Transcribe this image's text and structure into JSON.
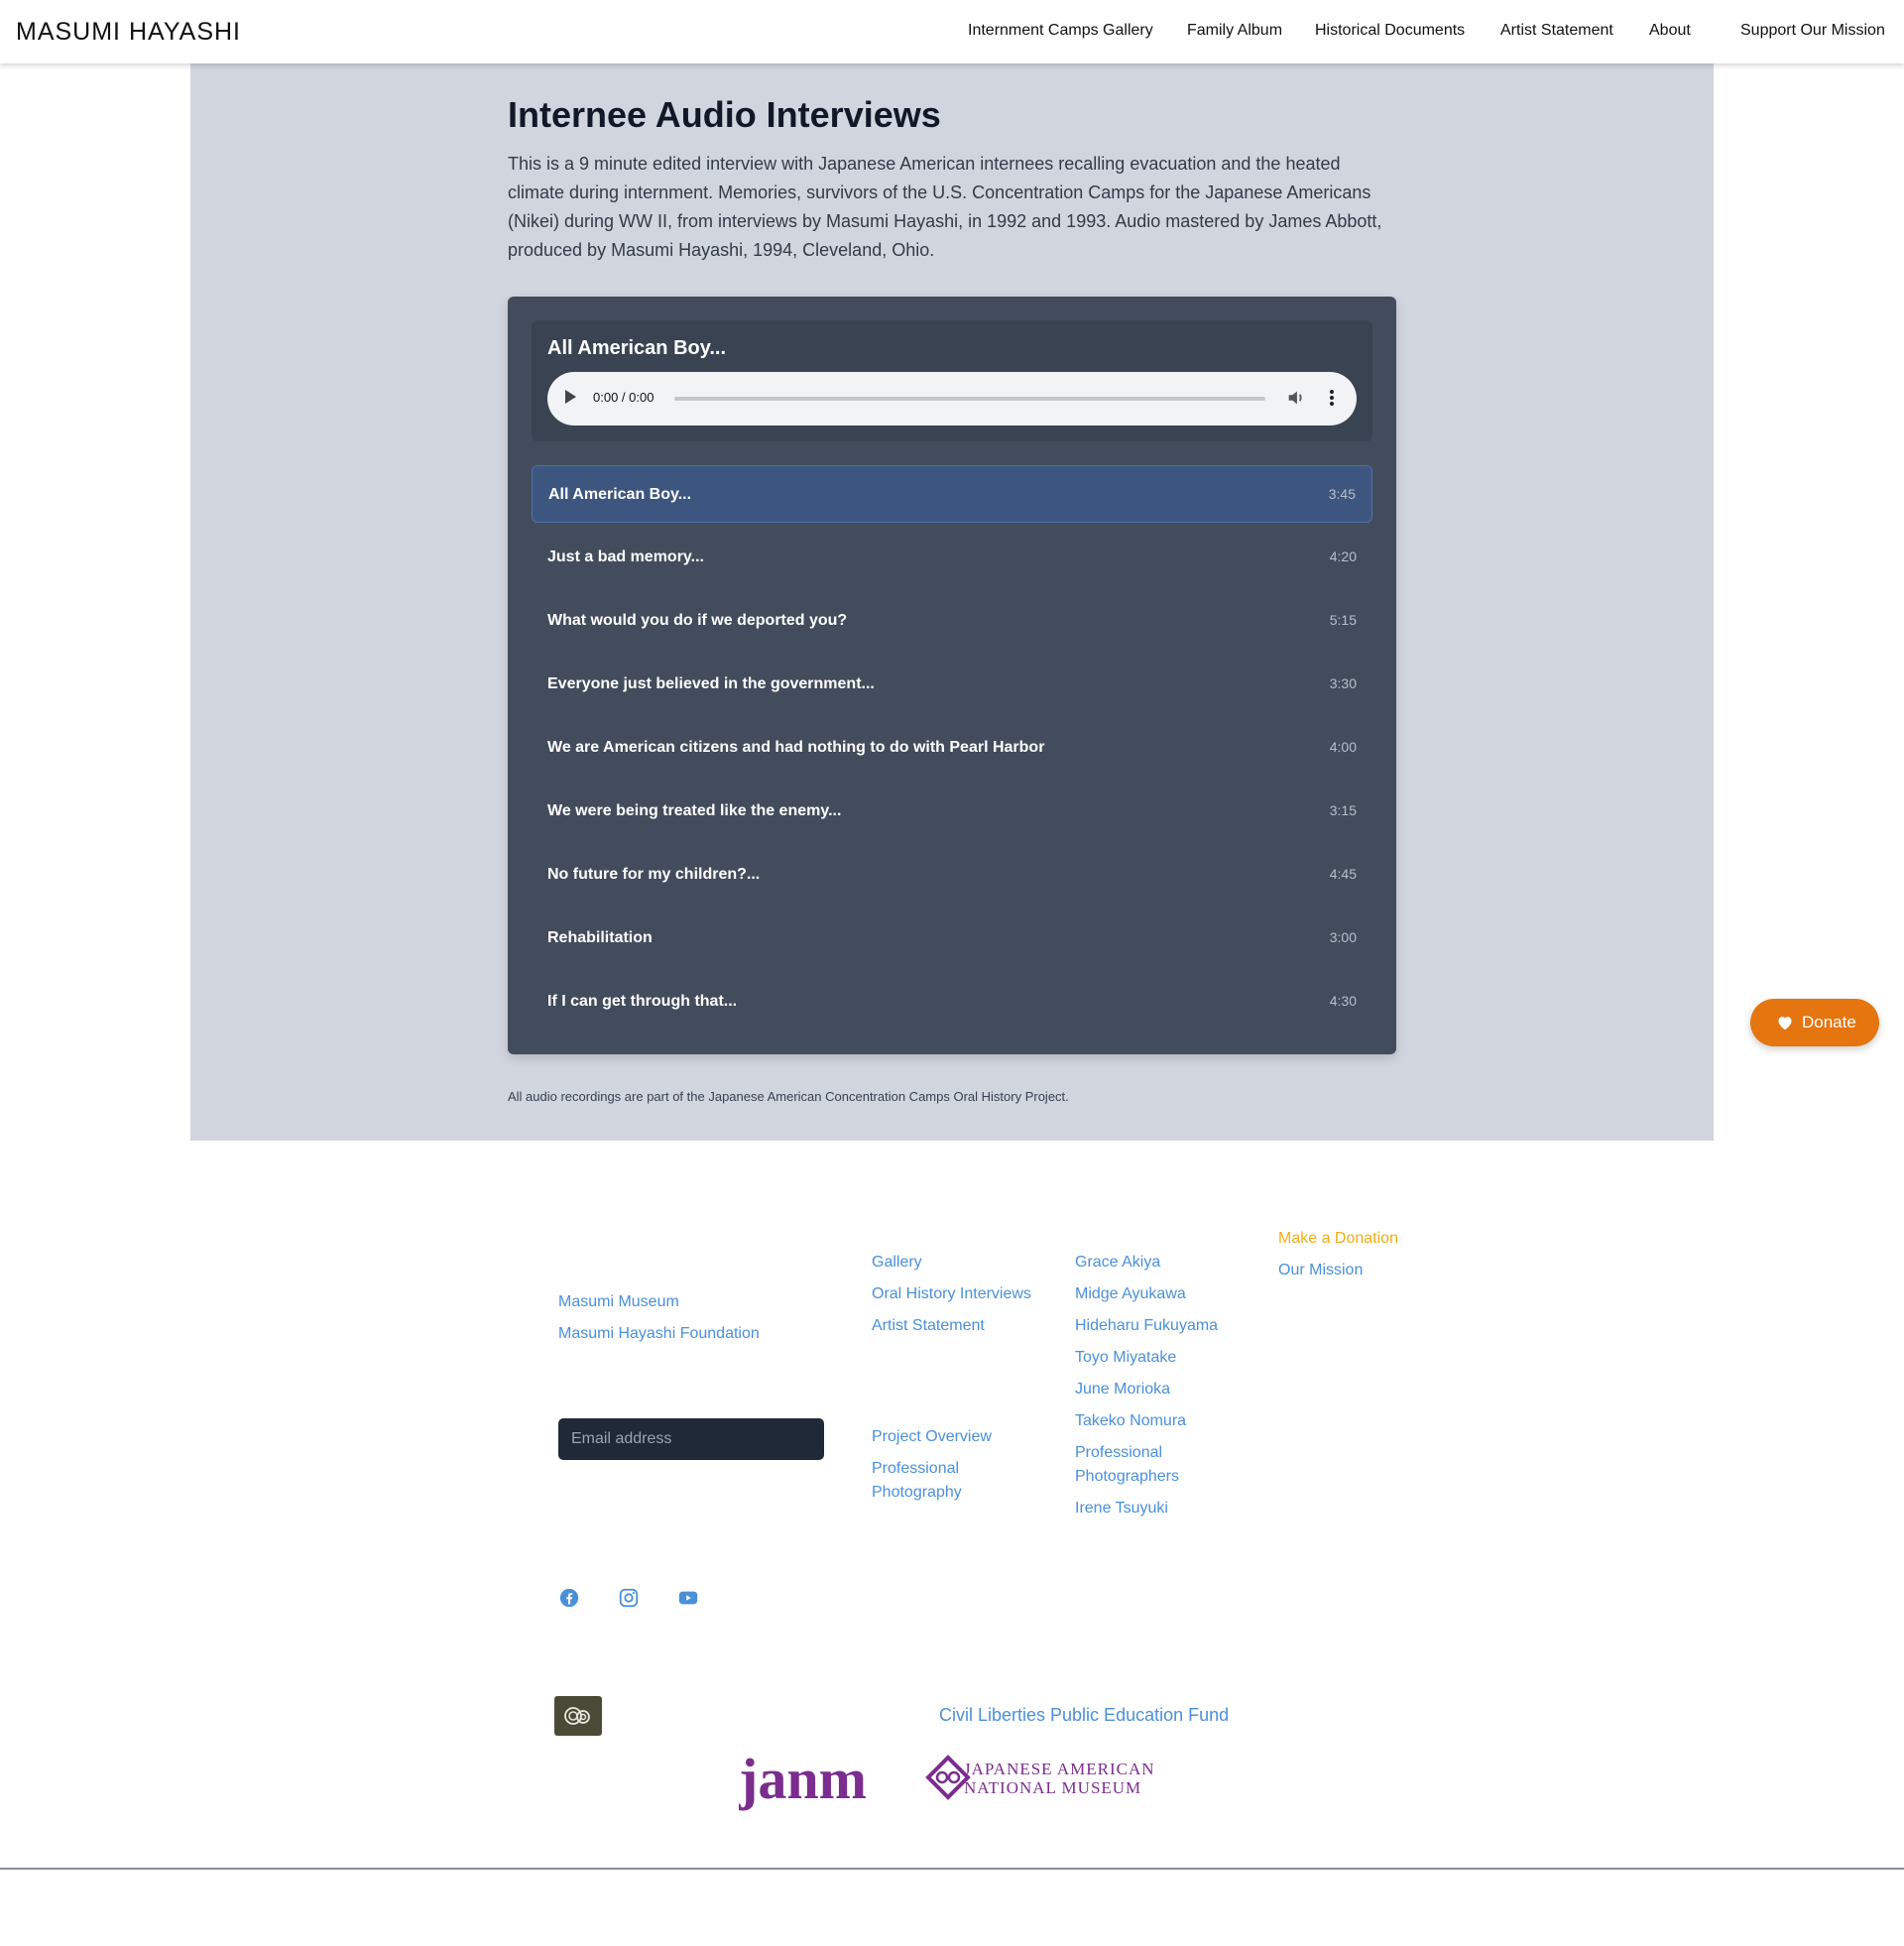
{
  "header": {
    "site_title": "MASUMI HAYASHI",
    "nav": [
      "Internment Camps Gallery",
      "Family Album",
      "Historical Documents",
      "Artist Statement",
      "About",
      "Support Our Mission"
    ]
  },
  "main": {
    "title": "Internee Audio Interviews",
    "intro": "This is a 9 minute edited interview with Japanese American internees recalling evacuation and the heated climate during internment. Memories, survivors of the U.S. Concentration Camps for the Japanese Americans (Nikei) during WW II, from interviews by Masumi Hayashi, in 1992 and 1993. Audio mastered by James Abbott, produced by Masumi Hayashi, 1994, Cleveland, Ohio.",
    "player": {
      "now_playing": "All American Boy...",
      "time_display": "0:00 / 0:00"
    },
    "tracks": [
      {
        "title": "All American Boy...",
        "duration": "3:45",
        "active": true
      },
      {
        "title": "Just a bad memory...",
        "duration": "4:20"
      },
      {
        "title": "What would you do if we deported you?",
        "duration": "5:15"
      },
      {
        "title": "Everyone just believed in the government...",
        "duration": "3:30"
      },
      {
        "title": "We are American citizens and had nothing to do with Pearl Harbor",
        "duration": "4:00"
      },
      {
        "title": "We were being treated like the enemy...",
        "duration": "3:15"
      },
      {
        "title": "No future for my children?...",
        "duration": "4:45"
      },
      {
        "title": "Rehabilitation",
        "duration": "3:00"
      },
      {
        "title": "If I can get through that...",
        "duration": "4:30"
      }
    ],
    "footnote": "All audio recordings are part of the Japanese American Concentration Camps Oral History Project."
  },
  "donate_button": {
    "label": "Donate",
    "icon": "heart-icon"
  },
  "footer": {
    "col1": [
      "Masumi Museum",
      "Masumi Hayashi Foundation"
    ],
    "email_placeholder": "Email address",
    "col2_top": [
      "Gallery",
      "Oral History Interviews",
      "Artist Statement"
    ],
    "col2_bottom": [
      "Project Overview",
      "Professional Photography"
    ],
    "col3": [
      "Grace Akiya",
      "Midge Ayukawa",
      "Hideharu Fukuyama",
      "Toyo Miyatake",
      "June Morioka",
      "Takeko Nomura",
      "Professional Photographers",
      "Irene Tsuyuki"
    ],
    "col4": [
      "Make a Donation",
      "Our Mission"
    ],
    "social": [
      "facebook-icon",
      "instagram-icon",
      "youtube-icon"
    ],
    "partner_link": "Civil Liberties Public Education Fund",
    "janm": {
      "wordmark": "janm",
      "line1": "JAPANESE AMERICAN",
      "line2": "NATIONAL MUSEUM"
    }
  },
  "colors": {
    "accent_link": "#4a90d9",
    "donate": "#e4750f",
    "highlight": "#f0ad16",
    "janm_purple": "#7b2d8e"
  }
}
